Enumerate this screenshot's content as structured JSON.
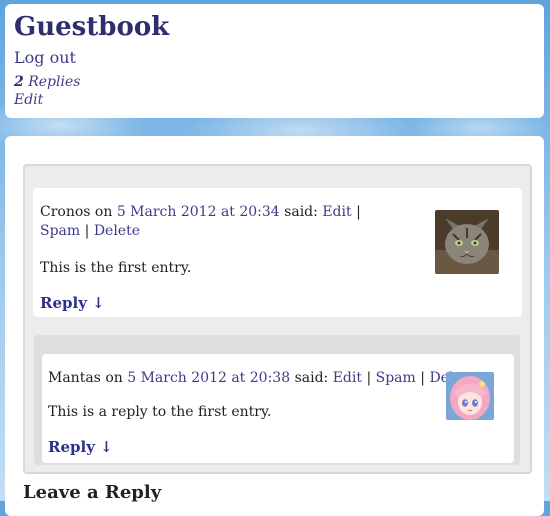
{
  "header": {
    "title": "Guestbook",
    "logout": "Log out",
    "replies_count": "2",
    "replies_label": "Replies",
    "edit": "Edit"
  },
  "comments": [
    {
      "author": "Cronos",
      "on": "on",
      "date": "5 March 2012 at 20:34",
      "said": "said:",
      "edit": "Edit",
      "spam": "Spam",
      "delete": "Delete",
      "sep": "|",
      "body": "This is the first entry.",
      "reply": "Reply ↓",
      "avatar": "cat-avatar"
    },
    {
      "author": "Mantas",
      "on": "on",
      "date": "5 March 2012 at 20:38",
      "said": "said:",
      "edit": "Edit",
      "spam": "Spam",
      "delete": "Delete",
      "sep": "|",
      "body": "This is a reply to the first entry.",
      "reply": "Reply ↓",
      "avatar": "anime-avatar"
    }
  ],
  "respond": {
    "title": "Leave a Reply"
  }
}
